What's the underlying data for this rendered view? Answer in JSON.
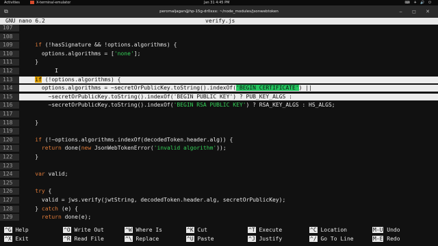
{
  "system_bar": {
    "activities": "Activities",
    "app_name": "X-terminal-emulator",
    "clock": "Jan 31  4:45 PM",
    "status_icons": "⌨ ✈ 🔊 ⏻"
  },
  "window": {
    "title": "peromaljagan@hp-15g-dr0xxx: ~/node_modules/jsonwebtoken",
    "left_icon": "⧉",
    "controls": "‒ ◻ ✕"
  },
  "nano": {
    "version": "GNU nano 6.2",
    "filename": "verify.js"
  },
  "lines": [
    {
      "num": "107",
      "parts": [
        {
          "t": ""
        }
      ]
    },
    {
      "num": "108",
      "parts": [
        {
          "t": ""
        }
      ]
    },
    {
      "num": "109",
      "parts": [
        {
          "t": "    "
        },
        {
          "t": "if",
          "c": "kw"
        },
        {
          "t": " (!hasSignature && !options.algorithms) {"
        }
      ]
    },
    {
      "num": "110",
      "parts": [
        {
          "t": "      options.algorithms = ["
        },
        {
          "t": "'none'",
          "c": "str"
        },
        {
          "t": "];"
        }
      ]
    },
    {
      "num": "111",
      "parts": [
        {
          "t": "    }"
        }
      ]
    },
    {
      "num": "112",
      "parts": [
        {
          "t": "          "
        },
        {
          "t": "I",
          "c": "cursor-beam"
        }
      ]
    },
    {
      "num": "113",
      "sel": true,
      "parts": [
        {
          "t": "    "
        },
        {
          "t": "if",
          "c": "hl-if"
        },
        {
          "t": " (!options.algorithms) {"
        }
      ]
    },
    {
      "num": "114",
      "sel": true,
      "parts": [
        {
          "t": "      options.algorithms = ~secretOrPublicKey.toString().indexOf("
        },
        {
          "t": "'BEGIN CERTIFICATE'",
          "c": "hl-word"
        },
        {
          "t": ") ||"
        }
      ]
    },
    {
      "num": "115",
      "sel": true,
      "parts": [
        {
          "t": "        ~secretOrPublicKey.toString().indexOf("
        },
        {
          "t": "'BEGIN PUBLIC KEY'",
          "c": "str"
        },
        {
          "t": ") ? PUB_KEY_ALGS :"
        }
      ]
    },
    {
      "num": "116",
      "parts": [
        {
          "t": "        ~secretOrPublicKey.toString().indexOf("
        },
        {
          "t": "'BEGIN RSA PUBLIC KEY'",
          "c": "str"
        },
        {
          "t": ") ? RSA_KEY_ALGS : HS_ALGS;"
        }
      ]
    },
    {
      "num": "117",
      "parts": [
        {
          "t": ""
        }
      ]
    },
    {
      "num": "118",
      "parts": [
        {
          "t": "    }"
        }
      ]
    },
    {
      "num": "119",
      "parts": [
        {
          "t": ""
        }
      ]
    },
    {
      "num": "120",
      "parts": [
        {
          "t": "    "
        },
        {
          "t": "if",
          "c": "kw"
        },
        {
          "t": " (!~options.algorithms.indexOf(decodedToken.header.alg)) {"
        }
      ]
    },
    {
      "num": "121",
      "parts": [
        {
          "t": "      "
        },
        {
          "t": "return",
          "c": "kw"
        },
        {
          "t": " done("
        },
        {
          "t": "new",
          "c": "kw"
        },
        {
          "t": " JsonWebTokenError("
        },
        {
          "t": "'invalid algorithm'",
          "c": "str"
        },
        {
          "t": "));"
        }
      ]
    },
    {
      "num": "122",
      "parts": [
        {
          "t": "    }"
        }
      ]
    },
    {
      "num": "123",
      "parts": [
        {
          "t": ""
        }
      ]
    },
    {
      "num": "124",
      "parts": [
        {
          "t": "    "
        },
        {
          "t": "var",
          "c": "kw"
        },
        {
          "t": " valid;"
        }
      ]
    },
    {
      "num": "125",
      "parts": [
        {
          "t": ""
        }
      ]
    },
    {
      "num": "126",
      "parts": [
        {
          "t": "    "
        },
        {
          "t": "try",
          "c": "kw"
        },
        {
          "t": " {"
        }
      ]
    },
    {
      "num": "127",
      "parts": [
        {
          "t": "      valid = jws.verify(jwtString, decodedToken.header.alg, secretOrPublicKey);"
        }
      ]
    },
    {
      "num": "128",
      "parts": [
        {
          "t": "    } "
        },
        {
          "t": "catch",
          "c": "kw"
        },
        {
          "t": " (e) {"
        }
      ]
    },
    {
      "num": "129",
      "parts": [
        {
          "t": "      "
        },
        {
          "t": "return",
          "c": "kw"
        },
        {
          "t": " done(e);"
        }
      ]
    }
  ],
  "shortcuts": [
    {
      "key": "^G",
      "label": "Help"
    },
    {
      "key": "^O",
      "label": "Write Out"
    },
    {
      "key": "^W",
      "label": "Where Is"
    },
    {
      "key": "^K",
      "label": "Cut"
    },
    {
      "key": "^T",
      "label": "Execute"
    },
    {
      "key": "^C",
      "label": "Location"
    },
    {
      "key": "M-U",
      "label": "Undo"
    },
    {
      "key": "^X",
      "label": "Exit"
    },
    {
      "key": "^R",
      "label": "Read File"
    },
    {
      "key": "^\\",
      "label": "Replace"
    },
    {
      "key": "^U",
      "label": "Paste"
    },
    {
      "key": "^J",
      "label": "Justify"
    },
    {
      "key": "^/",
      "label": "Go To Line"
    },
    {
      "key": "M-E",
      "label": "Redo"
    }
  ]
}
